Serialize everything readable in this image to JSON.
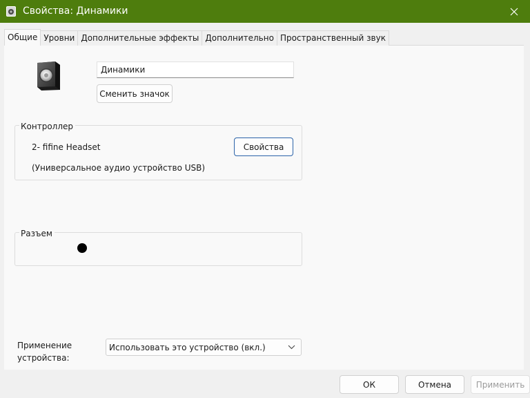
{
  "window": {
    "title": "Свойства: Динамики",
    "accent_color": "#4e7d0d",
    "icon": "speaker-icon",
    "close_icon": "close-icon"
  },
  "tabs": [
    {
      "label": "Общие",
      "active": true
    },
    {
      "label": "Уровни",
      "active": false
    },
    {
      "label": "Дополнительные эффекты",
      "active": false
    },
    {
      "label": "Дополнительно",
      "active": false
    },
    {
      "label": "Пространственный звук",
      "active": false
    }
  ],
  "general": {
    "device_name_value": "Динамики",
    "change_icon_button": "Сменить значок",
    "device_icon": "speaker-device-icon"
  },
  "controller": {
    "label": "Контроллер",
    "name": "2- fifine Headset",
    "description": "(Универсальное аудио устройство USB)",
    "properties_button": "Свойства"
  },
  "jack": {
    "label": "Разъем",
    "color": "#000000"
  },
  "device_usage": {
    "label": "Применение устройства:",
    "selected": "Использовать это устройство (вкл.)",
    "chevron_icon": "chevron-down-icon"
  },
  "buttons": {
    "ok": "ОК",
    "cancel": "Отмена",
    "apply": "Применить"
  }
}
